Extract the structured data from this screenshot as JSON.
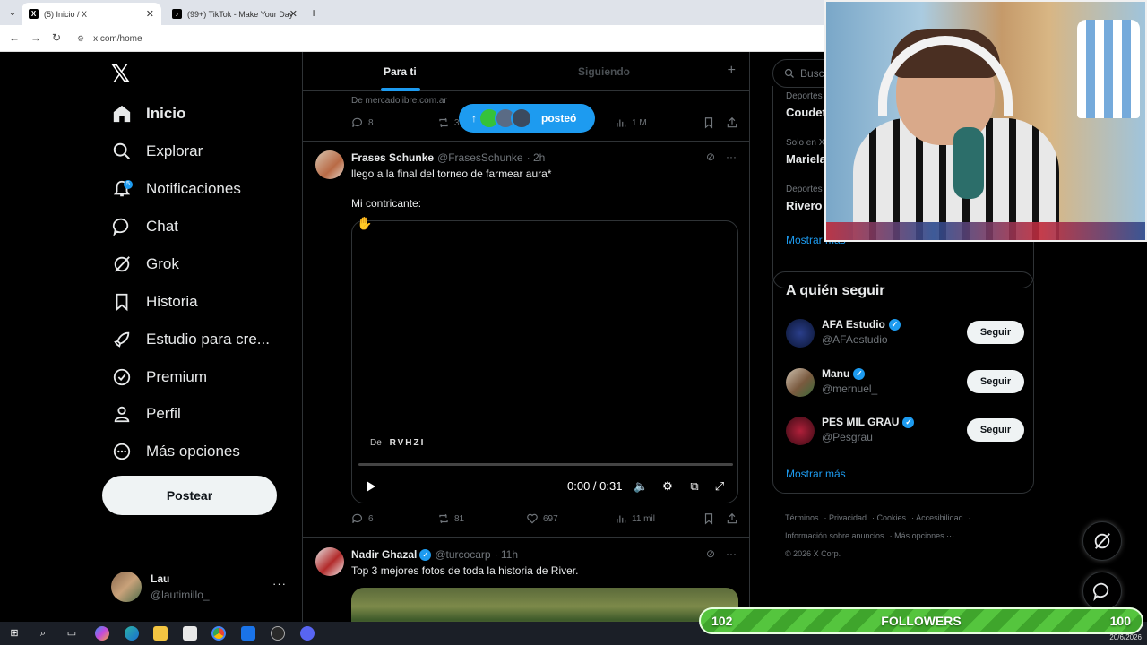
{
  "browser": {
    "tabs": [
      {
        "title": "(5) Inicio / X",
        "active": true
      },
      {
        "title": "(99+) TikTok - Make Your Day",
        "active": false
      }
    ],
    "url": "x.com/home"
  },
  "nav": {
    "items": [
      {
        "label": "Inicio",
        "icon": "home-icon"
      },
      {
        "label": "Explorar",
        "icon": "search-icon"
      },
      {
        "label": "Notificaciones",
        "icon": "bell-icon",
        "badge": "5"
      },
      {
        "label": "Chat",
        "icon": "chat-icon"
      },
      {
        "label": "Grok",
        "icon": "grok-icon"
      },
      {
        "label": "Historia",
        "icon": "bookmark-icon"
      },
      {
        "label": "Estudio para cre...",
        "icon": "rocket-icon"
      },
      {
        "label": "Premium",
        "icon": "premium-icon"
      },
      {
        "label": "Perfil",
        "icon": "person-icon"
      },
      {
        "label": "Más opciones",
        "icon": "more-icon"
      }
    ],
    "post_button": "Postear",
    "profile": {
      "name": "Lau",
      "handle": "@lautimillo_"
    }
  },
  "feed": {
    "tabs": [
      "Para ti",
      "Siguiendo"
    ],
    "prev_post": {
      "source": "De mercadolibre.com.ar",
      "replies": "8",
      "retweets": "3",
      "views": "1 M"
    },
    "posted_pill": "posteó",
    "tweets": [
      {
        "name": "Frases Schunke",
        "handle": "@FrasesSchunke",
        "time": "· 2h",
        "line1": "llego a la final del torneo de farmear aura*",
        "line2": "Mi contricante:",
        "video": {
          "from_label": "De",
          "from_source": "RVHZI",
          "time": "0:00 / 0:31",
          "progress": 0
        },
        "replies": "6",
        "retweets": "81",
        "likes": "697",
        "views": "11 mil"
      },
      {
        "name": "Nadir Ghazal",
        "handle": "@turcocarp",
        "time": "· 11h",
        "text": "Top 3 mejores fotos de toda la historia de River.",
        "verified": true
      }
    ]
  },
  "right": {
    "search_placeholder": "Busca",
    "trends": [
      {
        "category": "Deportes",
        "name": "Coudet"
      },
      {
        "category": "Solo en X",
        "name": "Mariela"
      },
      {
        "category": "Deportes",
        "name": "Rivero"
      }
    ],
    "trends_more": "Mostrar más",
    "who_to_follow": {
      "title": "A quién seguir",
      "accounts": [
        {
          "name": "AFA Estudio",
          "handle": "@AFAestudio",
          "button": "Seguir"
        },
        {
          "name": "Manu",
          "handle": "@mernuel_",
          "button": "Seguir"
        },
        {
          "name": "PES MIL GRAU",
          "handle": "@Pesgrau",
          "button": "Seguir"
        }
      ],
      "more": "Mostrar más"
    },
    "footer": {
      "links": [
        "Términos",
        "Privacidad",
        "Cookies",
        "Accesibilidad",
        "Información sobre anuncios",
        "Más opciones ···"
      ],
      "copyright": "© 2026 X Corp."
    }
  },
  "overlay": {
    "followers_label": "FOLLOWERS",
    "followers_current": "102",
    "followers_goal": "100"
  },
  "taskbar": {
    "date": "20/6/2026"
  },
  "colors": {
    "accent": "#1d9bf0",
    "background": "#000000",
    "border": "#2f3336",
    "muted": "#71767b"
  }
}
